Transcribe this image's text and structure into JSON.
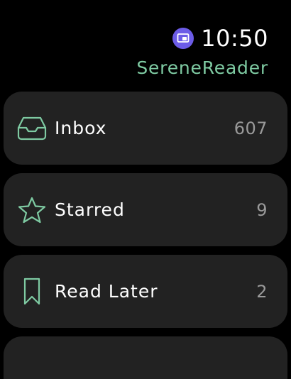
{
  "colors": {
    "accent": "#7ecaa2",
    "indicator": "#6c5ce7",
    "row_bg": "#222222",
    "count_text": "#9a9a9a"
  },
  "status": {
    "indicator_icon": "screen-sharing-icon",
    "time": "10:50"
  },
  "app": {
    "title": "SereneReader"
  },
  "mailboxes": [
    {
      "icon": "inbox-tray-icon",
      "label": "Inbox",
      "count": "607"
    },
    {
      "icon": "star-icon",
      "label": "Starred",
      "count": "9"
    },
    {
      "icon": "bookmark-icon",
      "label": "Read Later",
      "count": "2"
    }
  ]
}
